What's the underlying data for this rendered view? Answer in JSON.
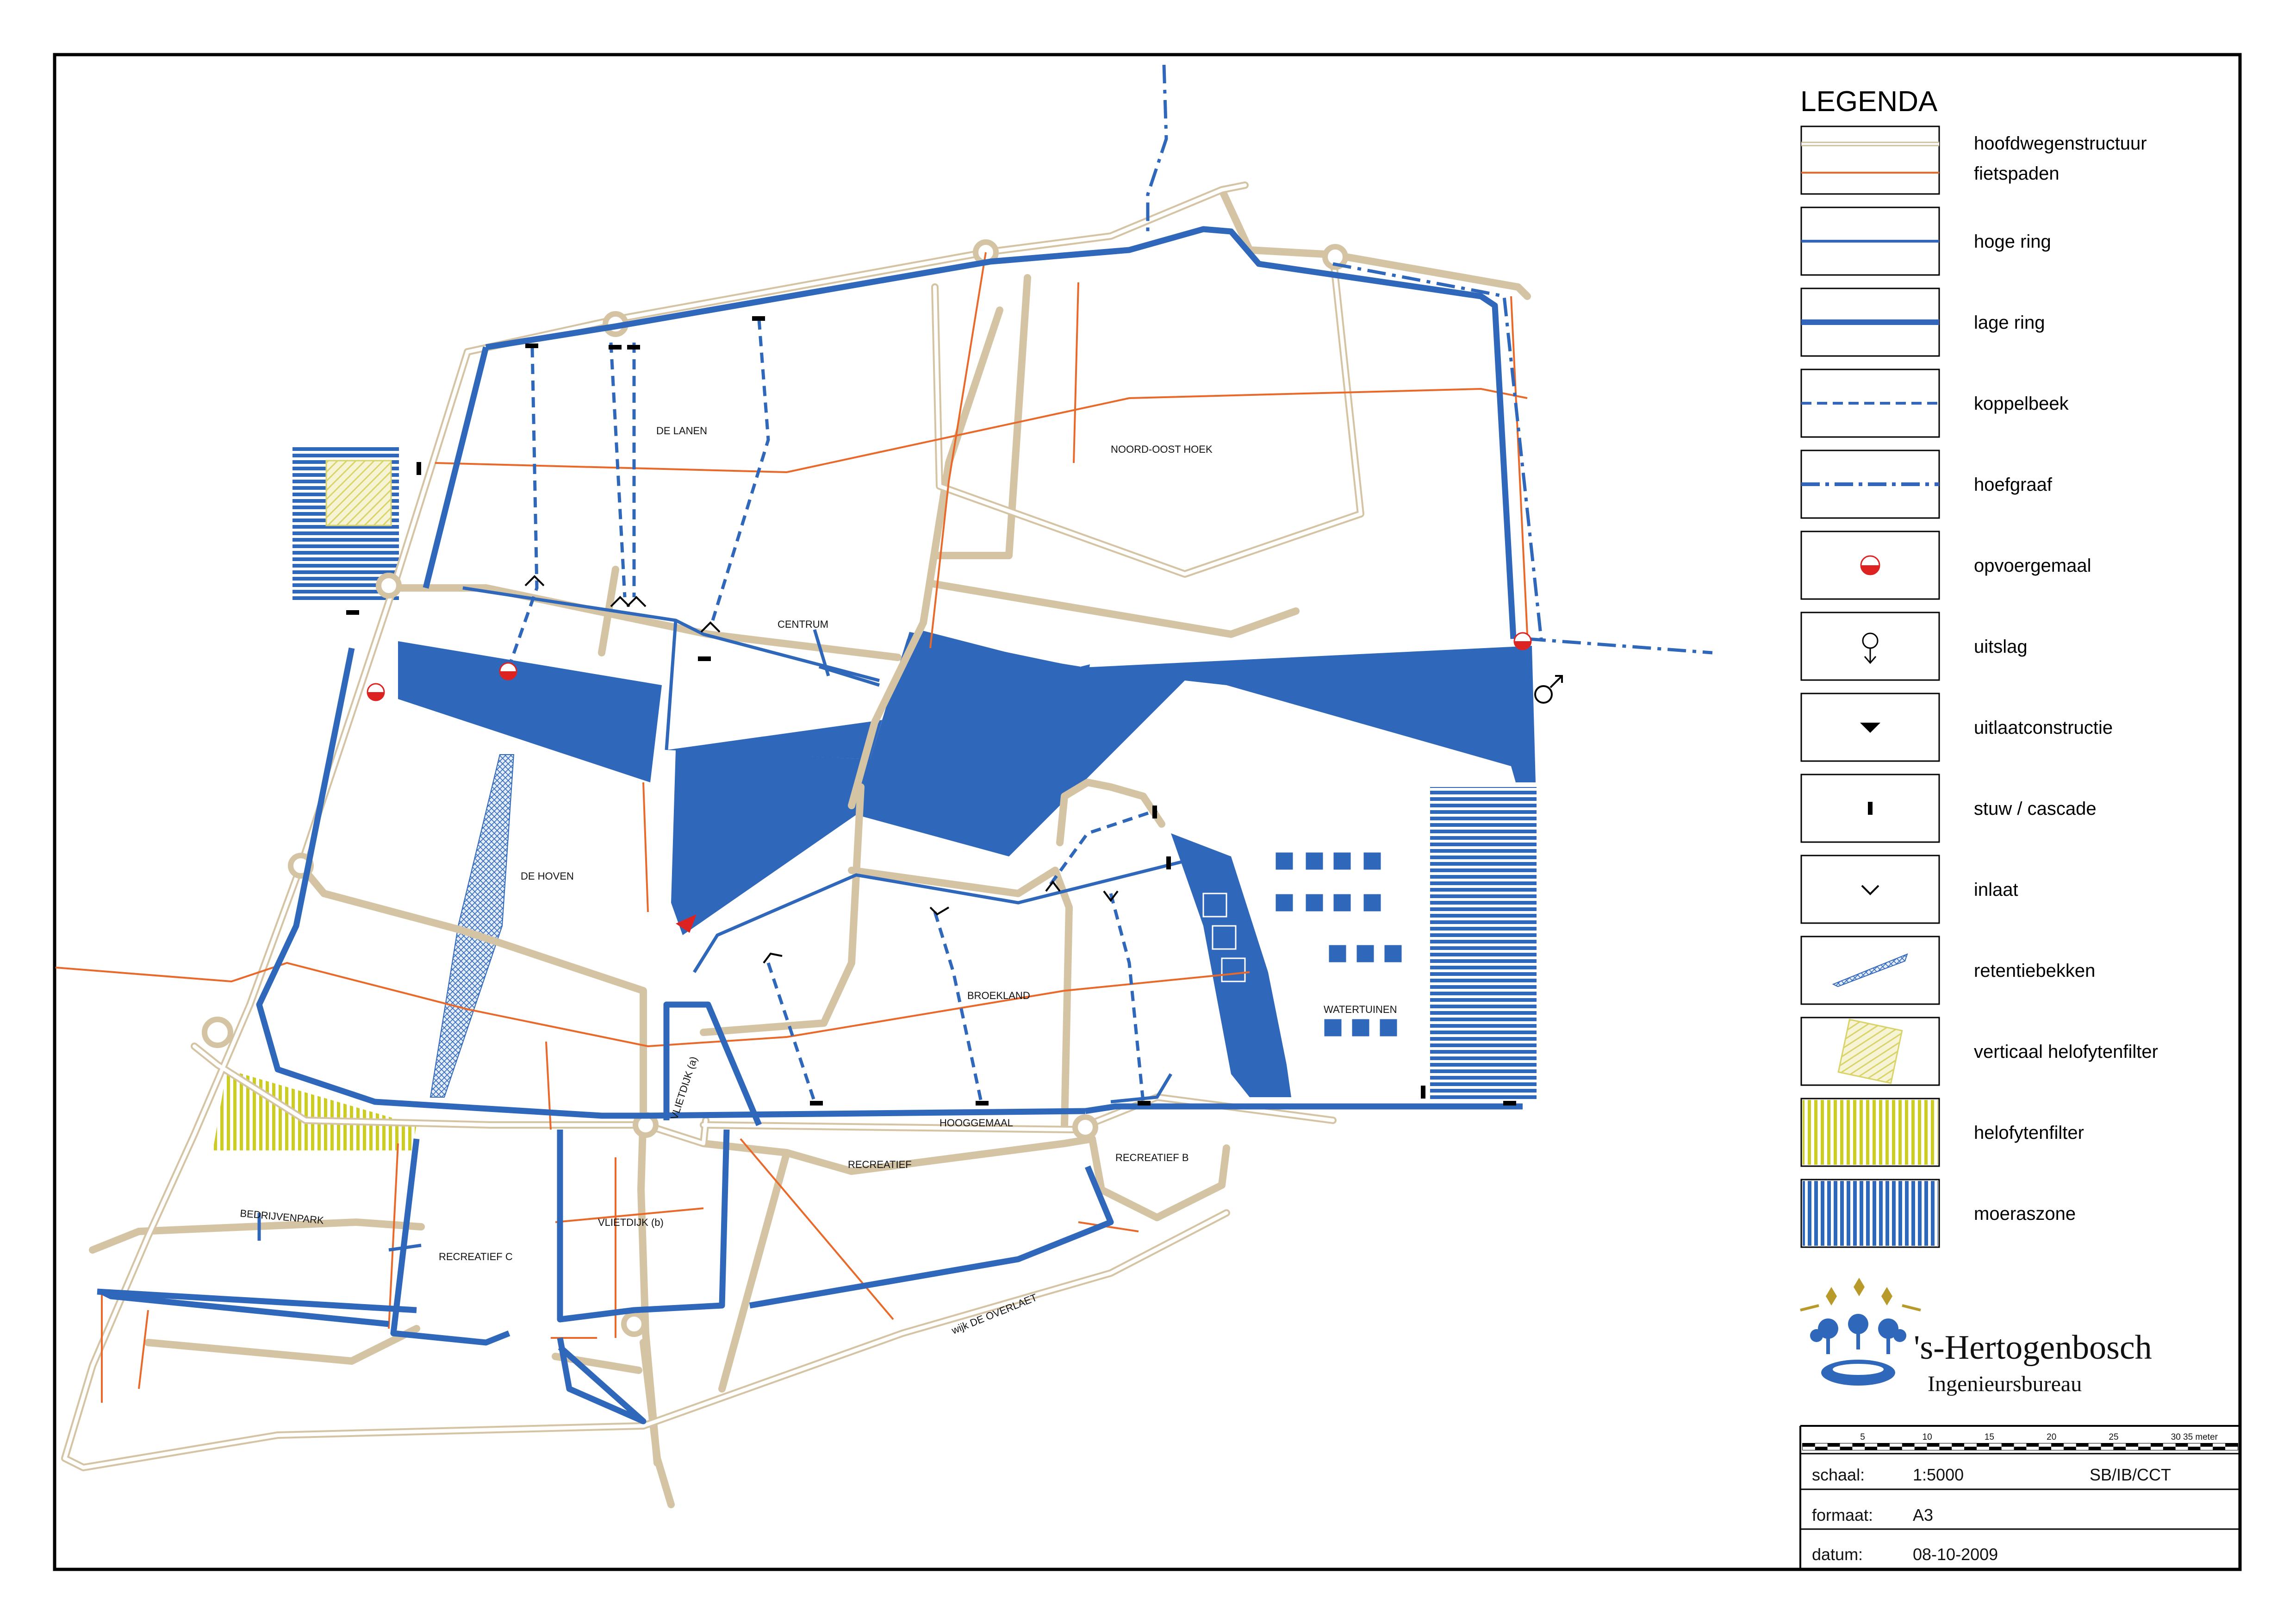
{
  "legend": {
    "title": "LEGENDA",
    "items": [
      {
        "label": "hoofdwegenstructuur",
        "symbol": "road",
        "color": "#d4c4a4"
      },
      {
        "label": "fietspaden",
        "symbol": "bike-path",
        "color": "#e8692a"
      },
      {
        "label": "hoge ring",
        "symbol": "high-ring",
        "color": "#3366bb"
      },
      {
        "label": "lage ring",
        "symbol": "low-ring",
        "color": "#3366bb"
      },
      {
        "label": "koppelbeek",
        "symbol": "dashed-line",
        "color": "#3366bb"
      },
      {
        "label": "hoefgraaf",
        "symbol": "dashdot-line",
        "color": "#3366bb"
      },
      {
        "label": "opvoergemaal",
        "symbol": "pump-icon",
        "color": "#dd2222"
      },
      {
        "label": "uitslag",
        "symbol": "outlet-icon",
        "color": "#000000"
      },
      {
        "label": "uitlaatconstructie",
        "symbol": "triangle-icon",
        "color": "#000000"
      },
      {
        "label": "stuw / cascade",
        "symbol": "weir-icon",
        "color": "#000000"
      },
      {
        "label": "inlaat",
        "symbol": "inlet-icon",
        "color": "#000000"
      },
      {
        "label": "retentiebekken",
        "symbol": "crosshatch",
        "color": "#3366bb"
      },
      {
        "label": "verticaal helofytenfilter",
        "symbol": "diagonal-hatch",
        "color": "#d8d46a"
      },
      {
        "label": "helofytenfilter",
        "symbol": "vertical-hatch-yellow",
        "color": "#cccc22"
      },
      {
        "label": "moeraszone",
        "symbol": "vertical-hatch-blue",
        "color": "#3366bb"
      }
    ]
  },
  "map_labels": {
    "de_lanen": "DE LANEN",
    "noord_oost_hoek": "NOORD-OOST HOEK",
    "centrum": "CENTRUM",
    "de_hoven": "DE HOVEN",
    "broekland": "BROEKLAND",
    "watertuinen": "WATERTUINEN",
    "vlietdijk_a": "VLIETDIJK (a)",
    "hooggemaal": "HOOGGEMAAL",
    "recreatief": "RECREATIEF",
    "recreatief_b": "RECREATIEF B",
    "recreatief_c": "RECREATIEF C",
    "bedrijvenpark": "BEDRIJVENPARK",
    "vlietdijk_b": "VLIETDIJK (b)",
    "wijk_de_overlaet": "wijk DE OVERLAET"
  },
  "logo": {
    "name": "'s-Hertogenbosch",
    "subtitle": "Ingenieursbureau"
  },
  "scale_bar": {
    "ticks": [
      "5",
      "10",
      "15",
      "20",
      "25",
      "30",
      "35 meter"
    ]
  },
  "title_block": {
    "schaal_label": "schaal:",
    "schaal_value": "1:5000",
    "code": "SB/IB/CCT",
    "formaat_label": "formaat:",
    "formaat_value": "A3",
    "datum_label": "datum:",
    "datum_value": "08-10-2009"
  },
  "colors": {
    "water": "#2f67bb",
    "road": "#d4c4a4",
    "bike": "#e8692a",
    "helofyt": "#cccc22",
    "frame": "#000000"
  }
}
